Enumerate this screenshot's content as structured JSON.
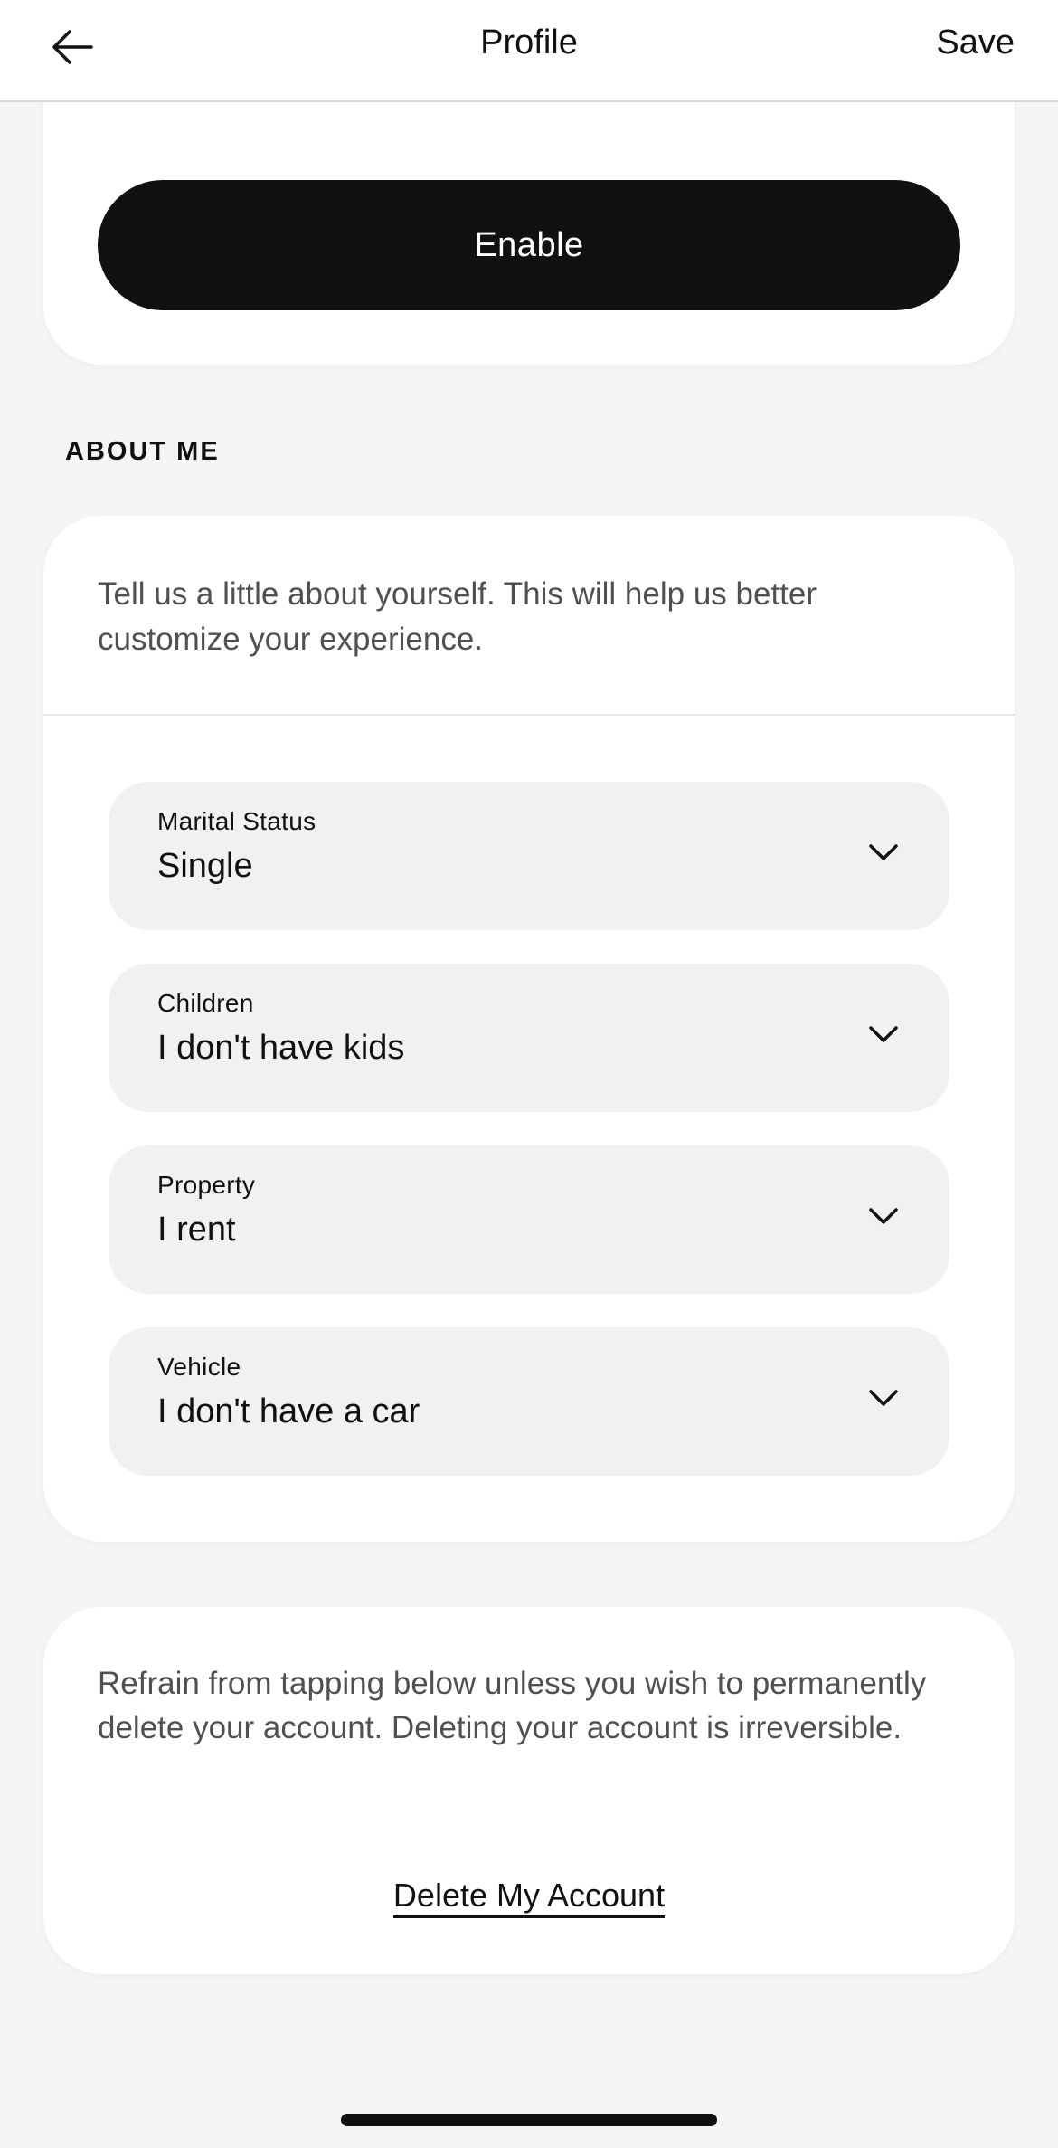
{
  "header": {
    "title": "Profile",
    "save_label": "Save",
    "back_icon": "arrow-left-icon"
  },
  "top_card": {
    "enable_label": "Enable"
  },
  "about_me": {
    "section_label": "ABOUT ME",
    "description": "Tell us a little about yourself. This will help us better customize your experience.",
    "fields": [
      {
        "label": "Marital Status",
        "value": "Single"
      },
      {
        "label": "Children",
        "value": "I don't have kids"
      },
      {
        "label": "Property",
        "value": "I rent"
      },
      {
        "label": "Vehicle",
        "value": "I don't have a car"
      }
    ]
  },
  "delete_card": {
    "description": "Refrain from tapping below unless you wish to permanently delete your account. Deleting your account is irreversible.",
    "delete_label": "Delete My Account"
  },
  "colors": {
    "background": "#f5f5f5",
    "card": "#ffffff",
    "primary_button": "#111111",
    "field_bg": "#f1f1f1",
    "muted_text": "#505050"
  }
}
